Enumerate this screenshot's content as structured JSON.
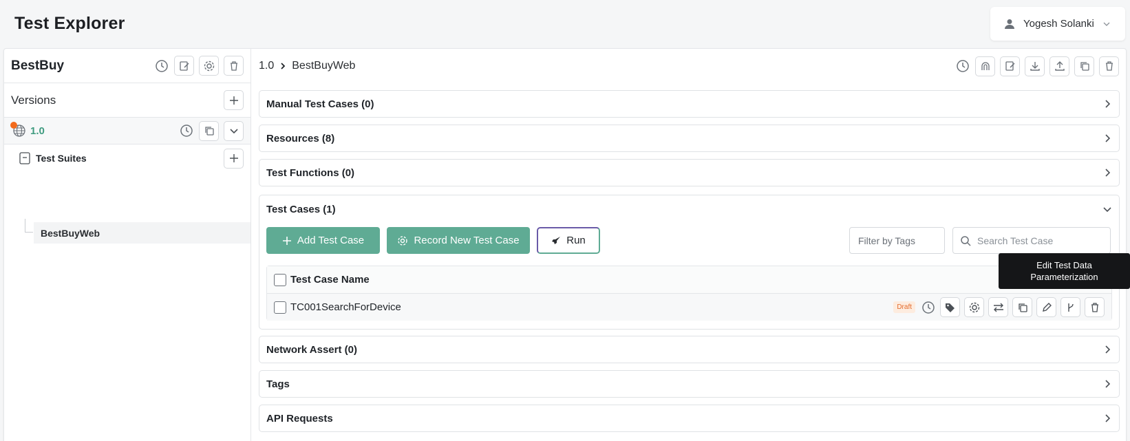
{
  "page": {
    "title": "Test Explorer"
  },
  "user": {
    "name": "Yogesh Solanki"
  },
  "project": {
    "name": "BestBuy"
  },
  "versions": {
    "label": "Versions",
    "current": "1.0"
  },
  "suites": {
    "label": "Test Suites",
    "items": [
      "BestBuyWeb"
    ]
  },
  "breadcrumb": {
    "version": "1.0",
    "suite": "BestBuyWeb"
  },
  "sections": {
    "manual": "Manual Test Cases (0)",
    "resources": "Resources (8)",
    "functions": "Test Functions (0)",
    "testcases": "Test Cases (1)",
    "network": "Network Assert (0)",
    "tags": "Tags",
    "api": "API Requests"
  },
  "toolbar": {
    "add_label": "Add Test Case",
    "record_label": "Record New Test Case",
    "run_label": "Run",
    "filter_label": "Filter by Tags",
    "search_placeholder": "Search Test Case"
  },
  "table": {
    "header": "Test Case Name",
    "rows": [
      {
        "name": "TC001SearchForDevice",
        "status": "Draft"
      }
    ]
  },
  "tooltip": {
    "text": "Edit Test Data Parameterization"
  },
  "colors": {
    "accent": "#5fab94",
    "status_draft": "#e46a2b",
    "version_text": "#3f9b80"
  }
}
